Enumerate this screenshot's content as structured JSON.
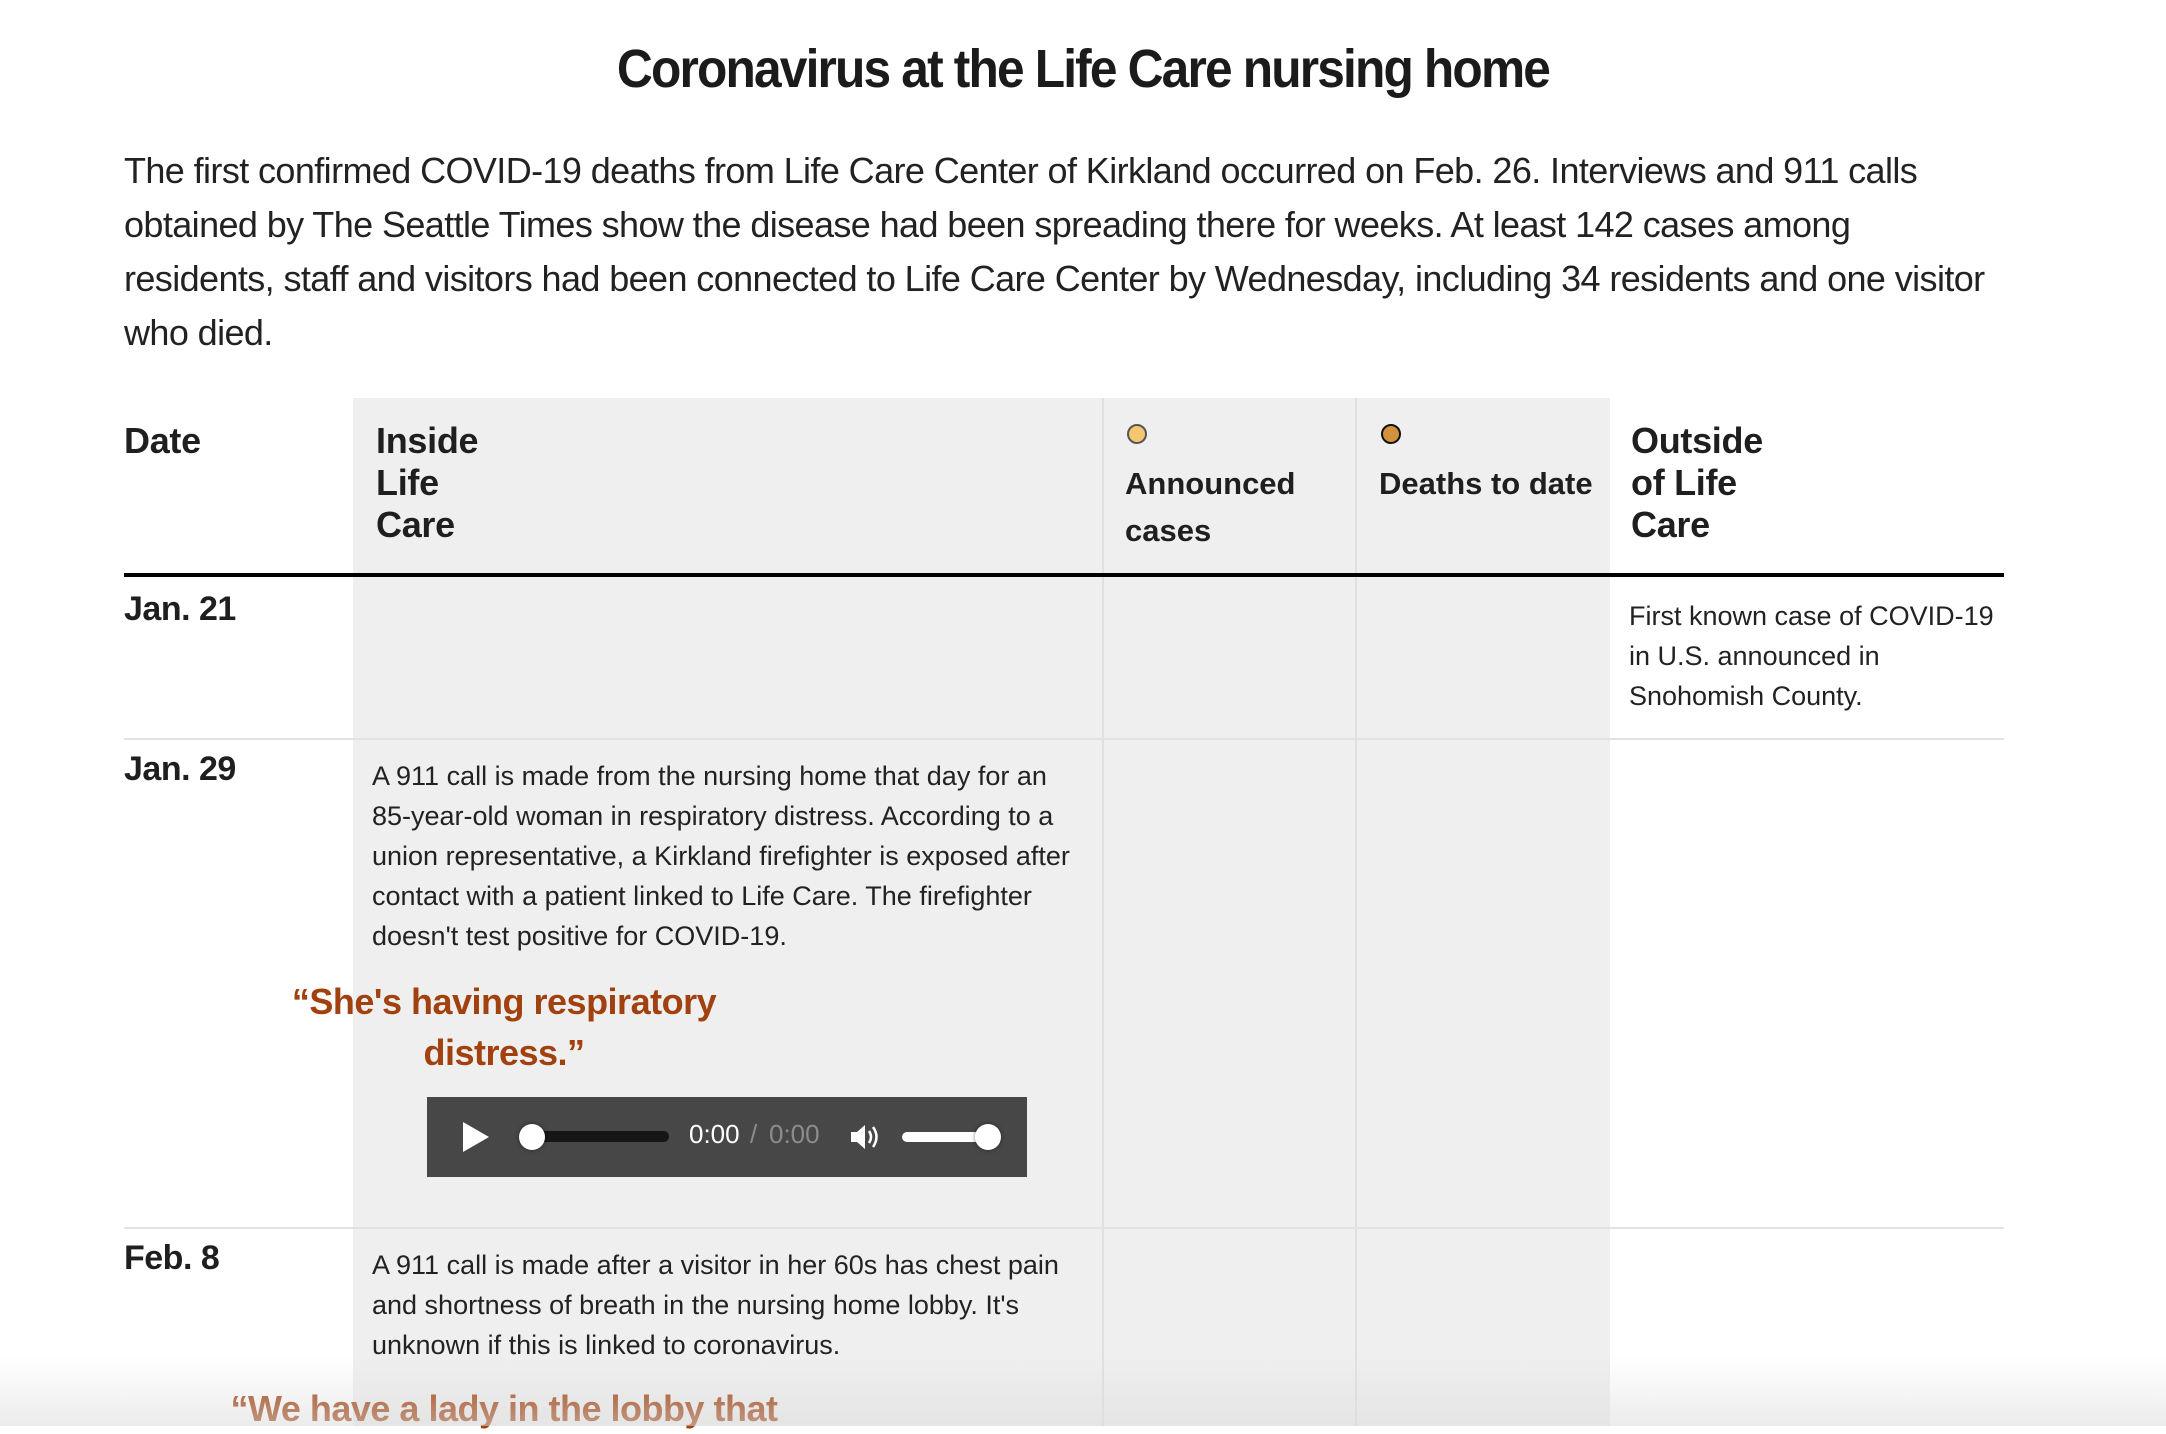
{
  "title": "Coronavirus at the Life Care nursing home",
  "intro": "The first confirmed COVID-19 deaths from Life Care Center of Kirkland occurred on Feb. 26. Interviews and 911 calls obtained by The Seattle Times show the disease had been spreading there for weeks. At least 142 cases among residents, staff and visitors had been connected to Life Care Center by Wednesday, including 34 residents and one visitor who died.",
  "columns": {
    "date": "Date",
    "inside": "Inside Life Care",
    "cases": "Announced cases",
    "deaths": "Deaths to date",
    "outside": "Outside of Life Care"
  },
  "legend_colors": {
    "cases_fill": "#f5c56f",
    "deaths_fill": "#d3913c",
    "quote": "#a0410f"
  },
  "rows": [
    {
      "date": "Jan. 21",
      "inside": "",
      "outside": "First known case of COVID-19 in U.S. announced in Snohomish County."
    },
    {
      "date": "Jan. 29",
      "inside": "A 911 call is made from the nursing home that day for an 85-year-old woman in respiratory distress. According to a union representative, a Kirkland firefighter is exposed after contact with a patient linked to Life Care. The firefighter doesn't test positive for COVID-19.",
      "quote": "“She's having respiratory distress.”",
      "audio": {
        "current": "0:00",
        "separator": "/",
        "duration": "0:00",
        "progress": 0,
        "volume": 1.0
      },
      "outside": ""
    },
    {
      "date": "Feb. 8",
      "inside": "A 911 call is made after a visitor in her 60s has chest pain and shortness of breath in the nursing home lobby. It's unknown if this is linked to coronavirus.",
      "quote": "“We have a lady in the lobby that",
      "outside": ""
    }
  ]
}
